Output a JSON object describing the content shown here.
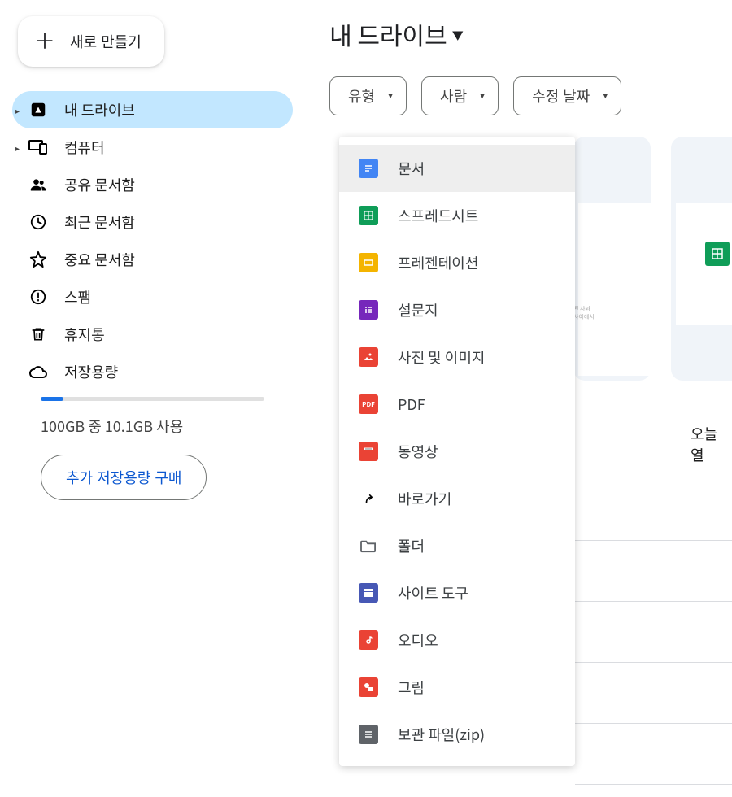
{
  "sidebar": {
    "new_button_label": "새로 만들기",
    "items": [
      {
        "label": "내 드라이브",
        "has_arrow": true,
        "active": true
      },
      {
        "label": "컴퓨터",
        "has_arrow": true
      },
      {
        "label": "공유 문서함"
      },
      {
        "label": "최근 문서함"
      },
      {
        "label": "중요 문서함"
      },
      {
        "label": "스팸"
      },
      {
        "label": "휴지통"
      },
      {
        "label": "저장용량"
      }
    ],
    "storage_text": "100GB 중 10.1GB 사용",
    "buy_storage_label": "추가 저장용량 구매"
  },
  "main": {
    "title": "내 드라이브",
    "filters": [
      {
        "label": "유형"
      },
      {
        "label": "사람"
      },
      {
        "label": "수정 날짜"
      }
    ],
    "card_label": "오늘 열",
    "snippet_line1": "된 사과",
    "snippet_line2": "사이에서"
  },
  "type_dropdown": {
    "items": [
      {
        "label": "문서",
        "hover": true
      },
      {
        "label": "스프레드시트"
      },
      {
        "label": "프레젠테이션"
      },
      {
        "label": "설문지"
      },
      {
        "label": "사진 및 이미지"
      },
      {
        "label": "PDF"
      },
      {
        "label": "동영상"
      },
      {
        "label": "바로가기"
      },
      {
        "label": "폴더"
      },
      {
        "label": "사이트 도구"
      },
      {
        "label": "오디오"
      },
      {
        "label": "그림"
      },
      {
        "label": "보관 파일(zip)"
      }
    ]
  }
}
